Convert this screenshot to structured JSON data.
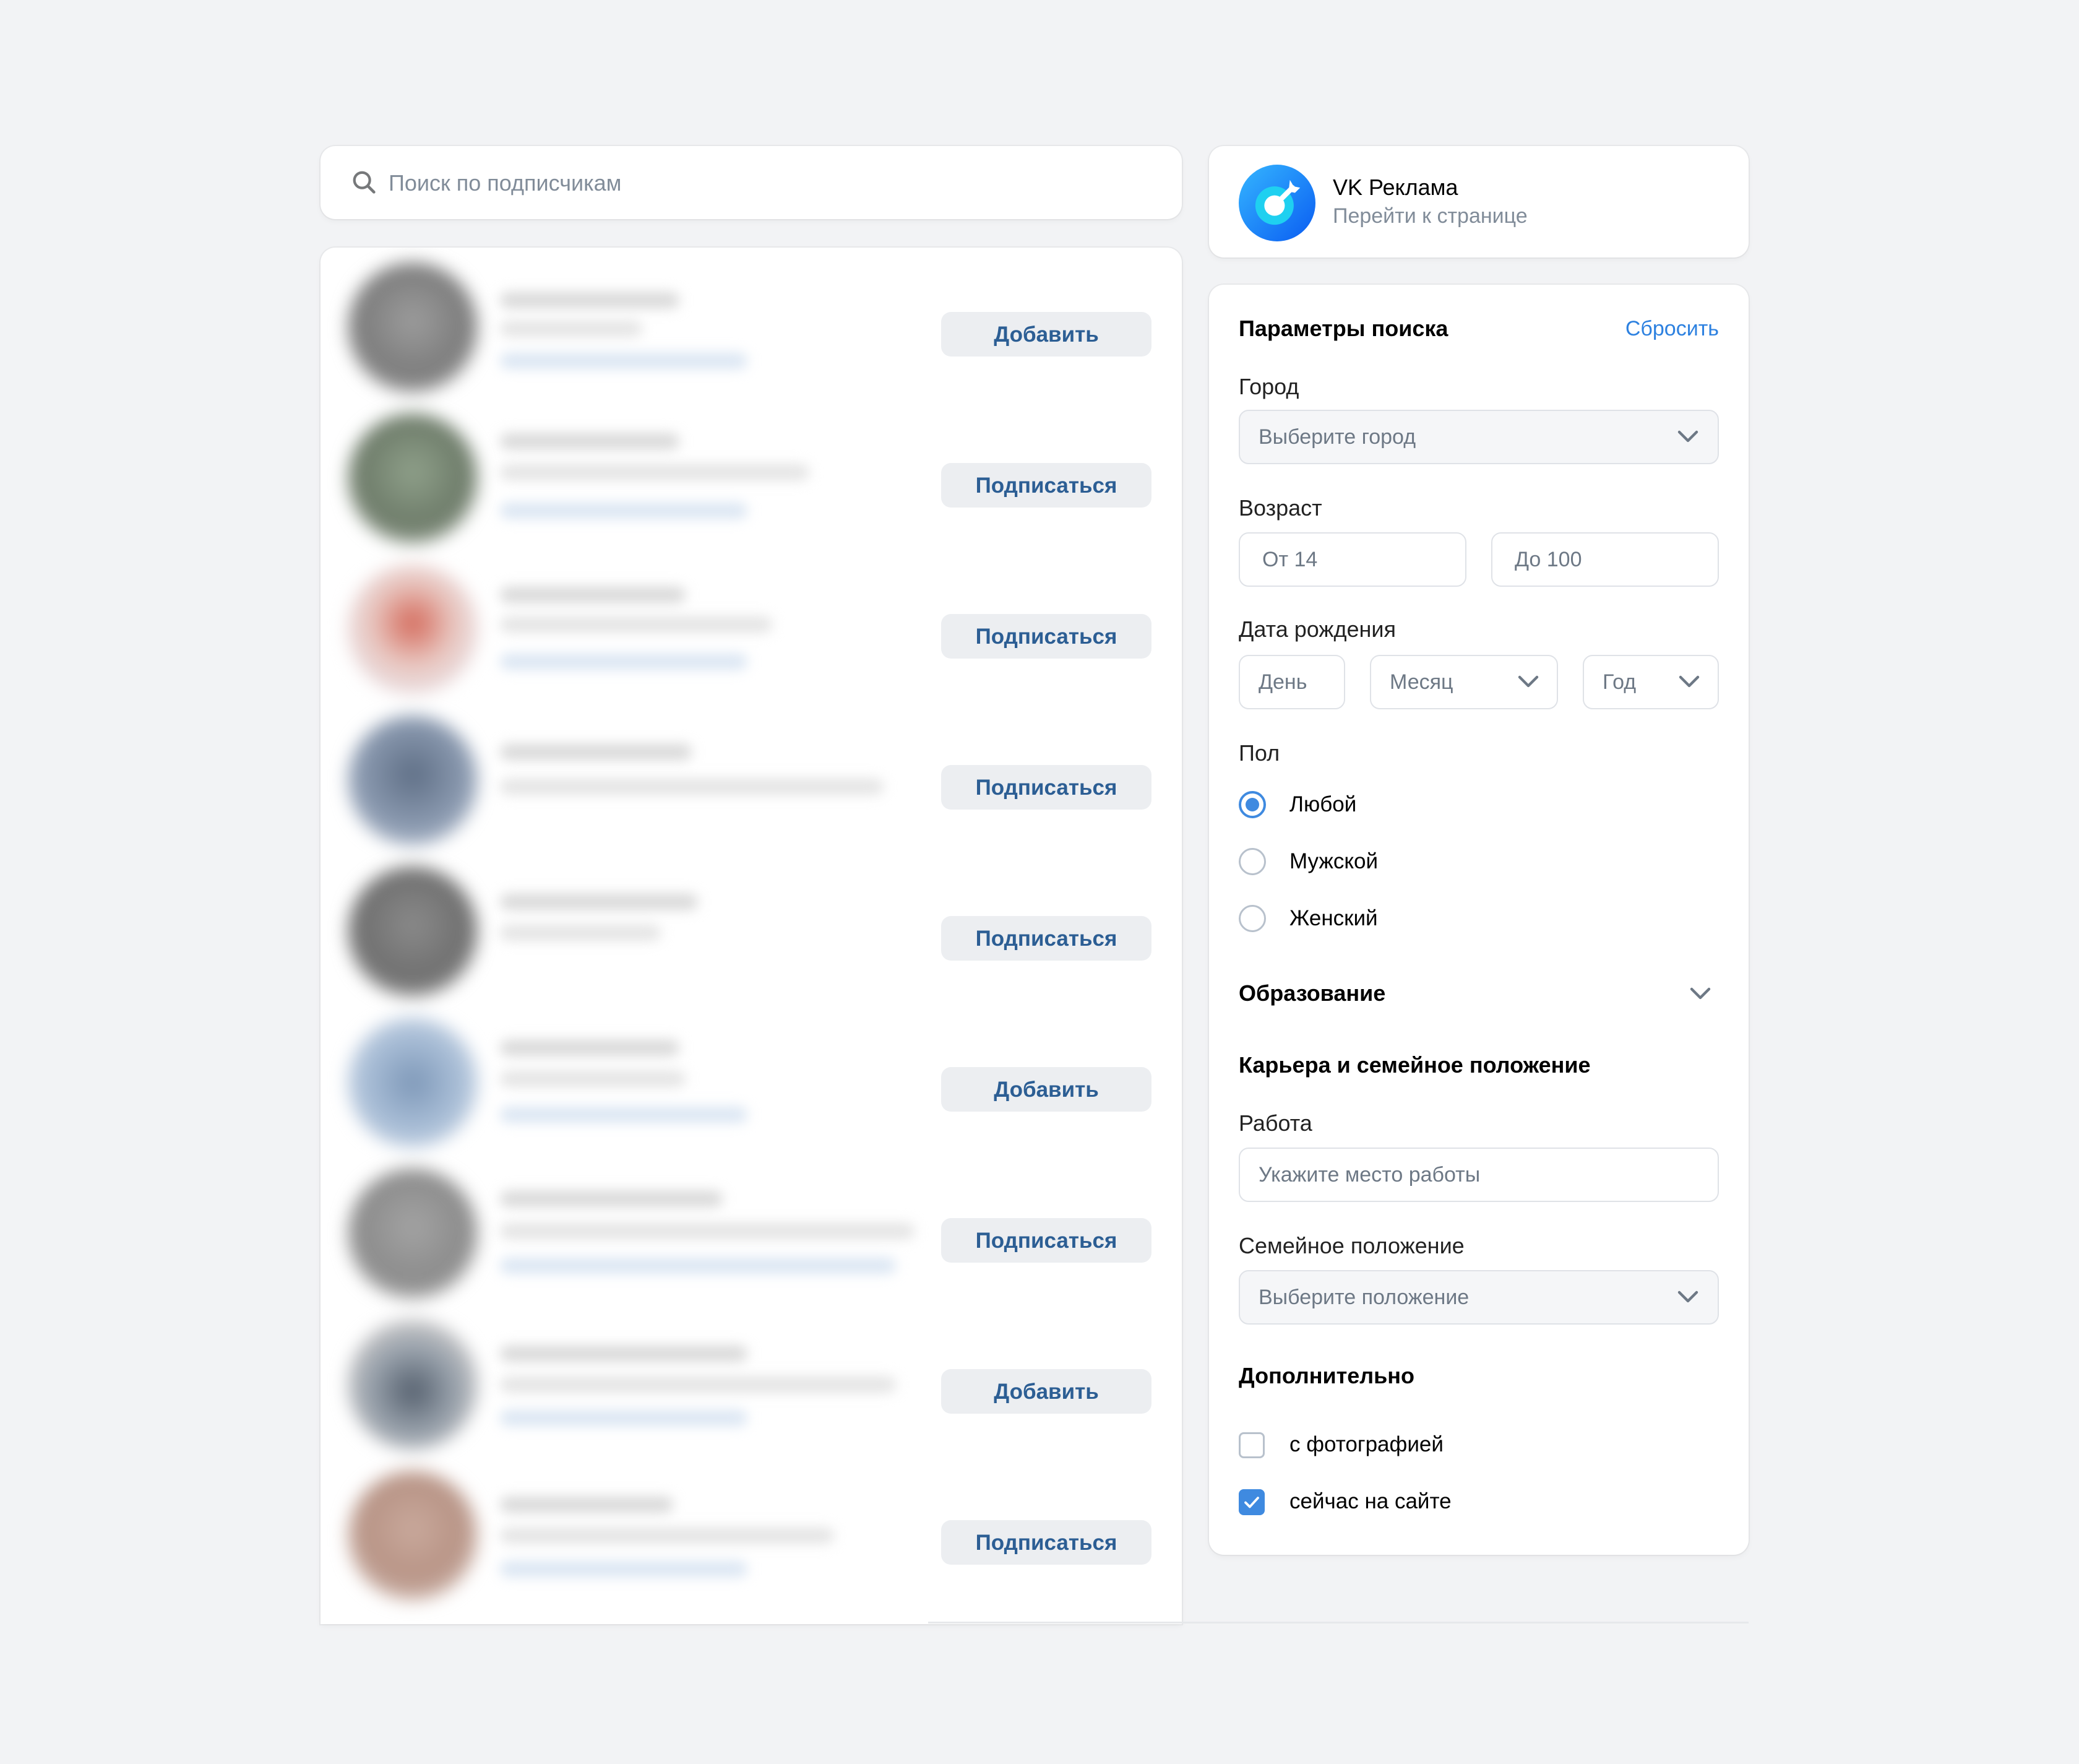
{
  "search": {
    "placeholder": "Поиск по подписчикам",
    "value": ""
  },
  "subscribers": [
    {
      "action": "Добавить"
    },
    {
      "action": "Подписаться"
    },
    {
      "action": "Подписаться"
    },
    {
      "action": "Подписаться"
    },
    {
      "action": "Подписаться"
    },
    {
      "action": "Добавить"
    },
    {
      "action": "Подписаться"
    },
    {
      "action": "Добавить"
    },
    {
      "action": "Подписаться"
    }
  ],
  "community": {
    "name": "VK Реклама",
    "link": "Перейти к странице",
    "logo_icon": "vk-ads-target-icon"
  },
  "filters": {
    "title": "Параметры поиска",
    "reset": "Сбросить",
    "city": {
      "label": "Город",
      "placeholder": "Выберите город"
    },
    "age": {
      "label": "Возраст",
      "from": "От 14",
      "to": "До 100"
    },
    "birth": {
      "label": "Дата рождения",
      "day": "День",
      "month": "Месяц",
      "year": "Год"
    },
    "gender": {
      "label": "Пол",
      "options": [
        "Любой",
        "Мужской",
        "Женский"
      ],
      "selected": "Любой"
    },
    "education": {
      "title": "Образование"
    },
    "career": {
      "title": "Карьера и семейное положение",
      "work_label": "Работа",
      "work_placeholder": "Укажите место работы",
      "family_label": "Семейное положение",
      "family_placeholder": "Выберите положение"
    },
    "extra": {
      "title": "Дополнительно",
      "with_photo": "с фотографией",
      "with_photo_checked": false,
      "online": "сейчас на сайте",
      "online_checked": true
    }
  },
  "colors": {
    "background": "#f2f3f5",
    "accent": "#3f8ae0",
    "link": "#2d81e0",
    "button_text": "#2c5e94",
    "button_bg": "#eceef1"
  }
}
